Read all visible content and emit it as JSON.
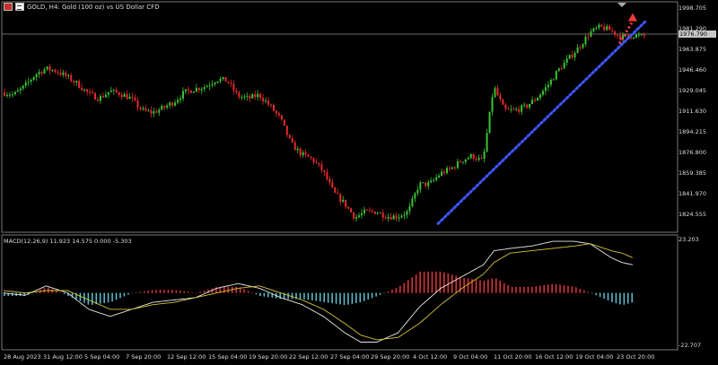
{
  "header": {
    "title": "GOLD, H4:  Gold (100 oz) vs US Dollar CFD"
  },
  "price_axis": {
    "labels": [
      "1998.705",
      "1963.875",
      "1946.460",
      "1929.045",
      "1911.630",
      "1894.215",
      "1876.800",
      "1859.385",
      "1841.970",
      "1824.555"
    ],
    "current_price": "1981.290",
    "hidden_price": "1976.790"
  },
  "macd": {
    "label": "MACD(12,26,9) 11.923 14.575 0.000 -5.303",
    "max_label": "23.203",
    "min_label": "-22.707"
  },
  "time_axis": {
    "labels": [
      "28 Aug 2023",
      "31 Aug 12:00",
      "5 Sep 04:00",
      "7 Sep 20:00",
      "12 Sep 12:00",
      "15 Sep 04:00",
      "19 Sep 20:00",
      "22 Sep 12:00",
      "27 Sep 04:00",
      "29 Sep 20:00",
      "4 Oct 12:00",
      "9 Oct 04:00",
      "11 Oct 20:00",
      "16 Oct 12:00",
      "19 Oct 04:00",
      "23 Oct 20:00"
    ]
  },
  "colors": {
    "bull": "#39c531",
    "bear": "#e8292b",
    "trendline": "#3d55ff",
    "arrow": "#ff3b3b",
    "macd_line": "#e6e6e6",
    "signal_line": "#d6c13a",
    "hist_pos": "#d9343a",
    "hist_neg": "#5bb8c8"
  },
  "chart_data": {
    "type": "candlestick",
    "price_path": [
      [
        0,
        1930
      ],
      [
        4,
        1928
      ],
      [
        8,
        1935
      ],
      [
        12,
        1945
      ],
      [
        16,
        1950
      ],
      [
        20,
        1948
      ],
      [
        24,
        1943
      ],
      [
        28,
        1937
      ],
      [
        32,
        1929
      ],
      [
        36,
        1925
      ],
      [
        40,
        1931
      ],
      [
        44,
        1929
      ],
      [
        48,
        1925
      ],
      [
        52,
        1915
      ],
      [
        56,
        1913
      ],
      [
        60,
        1917
      ],
      [
        64,
        1922
      ],
      [
        68,
        1930
      ],
      [
        72,
        1933
      ],
      [
        76,
        1935
      ],
      [
        80,
        1941
      ],
      [
        84,
        1940
      ],
      [
        88,
        1927
      ],
      [
        92,
        1925
      ],
      [
        96,
        1928
      ],
      [
        100,
        1919
      ],
      [
        104,
        1908
      ],
      [
        108,
        1887
      ],
      [
        112,
        1878
      ],
      [
        116,
        1874
      ],
      [
        120,
        1864
      ],
      [
        124,
        1846
      ],
      [
        128,
        1837
      ],
      [
        132,
        1825
      ],
      [
        136,
        1830
      ],
      [
        140,
        1830
      ],
      [
        144,
        1826
      ],
      [
        148,
        1826
      ],
      [
        152,
        1830
      ],
      [
        156,
        1853
      ],
      [
        160,
        1853
      ],
      [
        164,
        1862
      ],
      [
        168,
        1866
      ],
      [
        172,
        1873
      ],
      [
        176,
        1877
      ],
      [
        180,
        1872
      ],
      [
        184,
        1935
      ],
      [
        188,
        1915
      ],
      [
        192,
        1915
      ],
      [
        196,
        1918
      ],
      [
        200,
        1925
      ],
      [
        204,
        1935
      ],
      [
        208,
        1948
      ],
      [
        212,
        1958
      ],
      [
        216,
        1968
      ],
      [
        220,
        1980
      ],
      [
        224,
        1985
      ],
      [
        228,
        1982
      ],
      [
        232,
        1976
      ],
      [
        236,
        1978
      ],
      [
        240,
        1977
      ]
    ],
    "macd": [
      [
        0,
        0
      ],
      [
        8,
        -1
      ],
      [
        16,
        3
      ],
      [
        24,
        0
      ],
      [
        32,
        -7
      ],
      [
        40,
        -10
      ],
      [
        48,
        -7
      ],
      [
        56,
        -4
      ],
      [
        64,
        -3
      ],
      [
        72,
        -2
      ],
      [
        80,
        2
      ],
      [
        88,
        4
      ],
      [
        96,
        2
      ],
      [
        104,
        -2
      ],
      [
        112,
        -5
      ],
      [
        120,
        -10
      ],
      [
        128,
        -17
      ],
      [
        134,
        -21
      ],
      [
        140,
        -21
      ],
      [
        148,
        -17
      ],
      [
        156,
        -6
      ],
      [
        164,
        2
      ],
      [
        172,
        7
      ],
      [
        180,
        12
      ],
      [
        184,
        18
      ],
      [
        190,
        19
      ],
      [
        198,
        20
      ],
      [
        206,
        22
      ],
      [
        214,
        22
      ],
      [
        220,
        21
      ],
      [
        228,
        15
      ],
      [
        232,
        13
      ],
      [
        236,
        12
      ]
    ],
    "signal": [
      [
        0,
        1
      ],
      [
        8,
        0
      ],
      [
        16,
        1
      ],
      [
        24,
        1
      ],
      [
        32,
        -3
      ],
      [
        40,
        -7
      ],
      [
        48,
        -7
      ],
      [
        56,
        -5
      ],
      [
        64,
        -4
      ],
      [
        72,
        -2
      ],
      [
        80,
        0
      ],
      [
        88,
        2
      ],
      [
        96,
        3
      ],
      [
        104,
        0
      ],
      [
        112,
        -3
      ],
      [
        120,
        -7
      ],
      [
        128,
        -13
      ],
      [
        134,
        -18
      ],
      [
        140,
        -20
      ],
      [
        148,
        -19
      ],
      [
        156,
        -13
      ],
      [
        164,
        -5
      ],
      [
        172,
        2
      ],
      [
        180,
        8
      ],
      [
        184,
        13
      ],
      [
        190,
        17
      ],
      [
        198,
        18
      ],
      [
        206,
        19
      ],
      [
        214,
        20
      ],
      [
        220,
        21
      ],
      [
        228,
        18
      ],
      [
        232,
        17
      ],
      [
        236,
        15
      ]
    ],
    "trendline": {
      "from": [
        163,
        1820
      ],
      "to": [
        241,
        1990
      ]
    },
    "arrow": {
      "from": [
        231,
        1971
      ],
      "to": [
        236,
        1995
      ]
    },
    "y_range": [
      1815,
      2000
    ],
    "macd_range": [
      -22.707,
      23.203
    ]
  }
}
